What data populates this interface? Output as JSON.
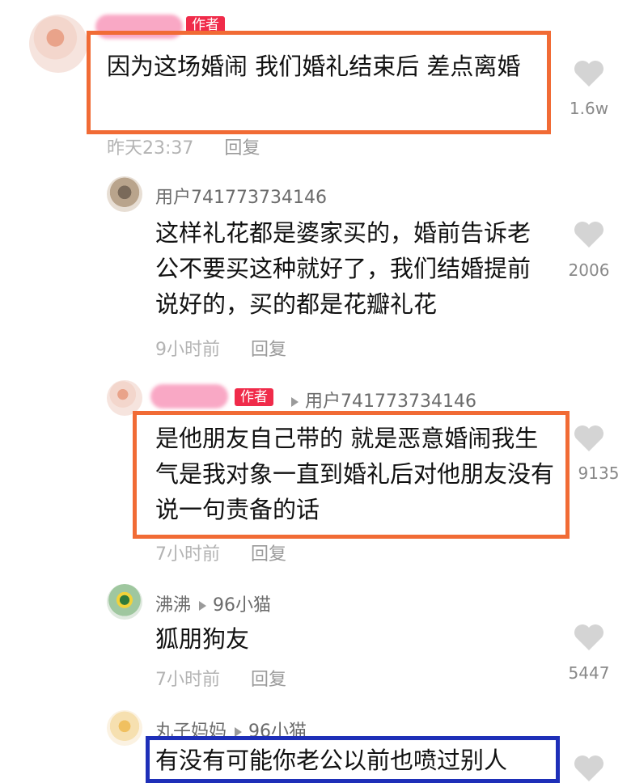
{
  "comments": [
    {
      "text": "因为这场婚闹 我们婚礼结束后 差点离婚",
      "badge": "作者",
      "time": "昨天23:37",
      "reply_label": "回复",
      "likes": "1.6w",
      "avatar_icon": "user-avatar-icon"
    },
    {
      "username": "用户741773734146",
      "text": "这样礼花都是婆家买的，婚前告诉老公不要买这种就好了，我们结婚提前说好的，买的都是花瓣礼花",
      "time": "9小时前",
      "reply_label": "回复",
      "likes": "2006"
    },
    {
      "badge": "作者",
      "reply_to": "用户741773734146",
      "text": "是他朋友自己带的 就是恶意婚闹我生气是我对象一直到婚礼后对他朋友没有说一句责备的话",
      "time": "7小时前",
      "reply_label": "回复",
      "likes": "9135"
    },
    {
      "username": "沸沸",
      "reply_to": "96小猫",
      "text": "狐朋狗友",
      "time": "7小时前",
      "reply_label": "回复",
      "likes": "5447"
    },
    {
      "username": "丸子妈妈",
      "reply_to": "96小猫",
      "text": "有没有可能你老公以前也喷过别人"
    }
  ],
  "colors": {
    "highlight_orange": "#f16b35",
    "highlight_blue": "#1e2fb8",
    "author_badge": "#f02b4a"
  }
}
